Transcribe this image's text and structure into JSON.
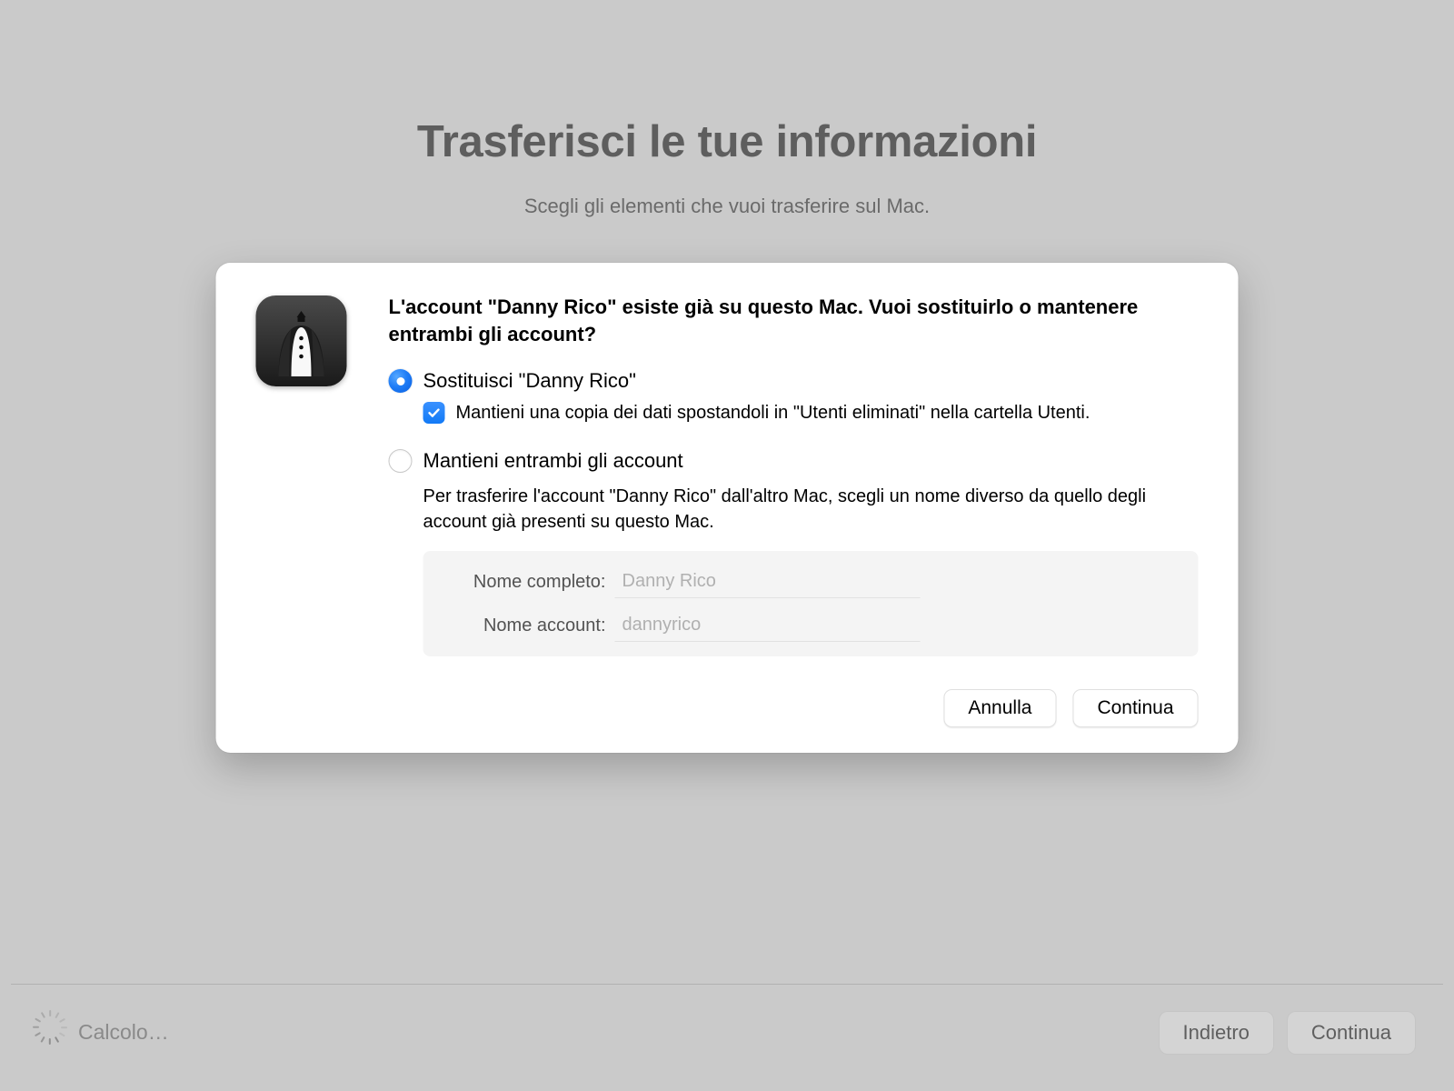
{
  "background": {
    "title": "Trasferisci le tue informazioni",
    "subtitle": "Scegli gli elementi che vuoi trasferire sul Mac."
  },
  "dialog": {
    "heading": "L'account \"Danny Rico\" esiste già su questo Mac. Vuoi sostituirlo o mantenere entrambi gli account?",
    "option_replace": "Sostituisci \"Danny Rico\"",
    "checkbox_keep_copy": "Mantieni una copia dei dati spostandoli in \"Utenti eliminati\" nella cartella Utenti.",
    "option_keep_both": "Mantieni entrambi gli account",
    "keep_both_desc": "Per trasferire l'account \"Danny Rico\" dall'altro Mac, scegli un nome diverso da quello degli account già presenti su questo Mac.",
    "form": {
      "full_name_label": "Nome completo:",
      "full_name_value": "Danny Rico",
      "account_name_label": "Nome account:",
      "account_name_value": "dannyrico"
    },
    "buttons": {
      "cancel": "Annulla",
      "continue": "Continua"
    }
  },
  "bottom": {
    "status": "Calcolo…",
    "back": "Indietro",
    "continue": "Continua"
  }
}
